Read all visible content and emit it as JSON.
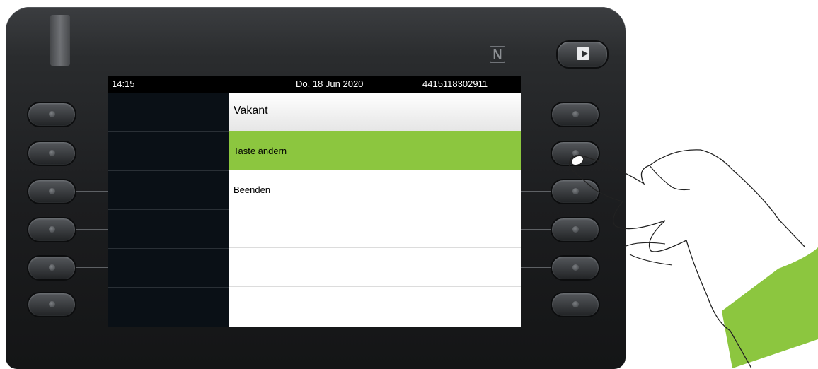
{
  "status": {
    "time": "14:15",
    "date": "Do, 18 Jun 2020",
    "number": "4415118302911"
  },
  "menu": {
    "title": "Vakant",
    "items": [
      {
        "label": "Taste ändern",
        "selected": true
      },
      {
        "label": "Beenden",
        "selected": false
      },
      {
        "label": "",
        "selected": false
      },
      {
        "label": "",
        "selected": false
      },
      {
        "label": "",
        "selected": false
      }
    ]
  },
  "hardware": {
    "nfc_icon": "nfc-icon",
    "exit_icon": "exit-icon"
  },
  "colors": {
    "highlight": "#8cc63f",
    "sleeve": "#8cc63f",
    "body": "#1c1d1f"
  }
}
